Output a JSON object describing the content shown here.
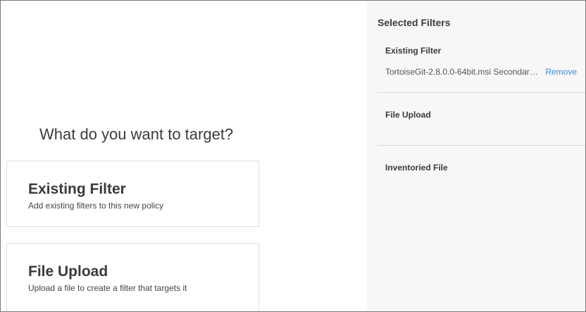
{
  "main": {
    "question": "What do you want to target?",
    "cards": [
      {
        "title": "Existing Filter",
        "description": "Add existing filters to this new policy"
      },
      {
        "title": "File Upload",
        "description": "Upload a file to create a filter that targets it"
      }
    ]
  },
  "panel": {
    "title": "Selected Filters",
    "sections": [
      {
        "title": "Existing Filter",
        "items": [
          {
            "text": "TortoiseGit-2.8.0.0-64bit.msi Secondary …",
            "action": "Remove"
          }
        ]
      },
      {
        "title": "File Upload",
        "items": []
      },
      {
        "title": "Inventoried File",
        "items": []
      }
    ]
  },
  "colors": {
    "link": "#3f88d6",
    "panel_bg": "#f7f7f7",
    "border": "#e0e0e0"
  }
}
